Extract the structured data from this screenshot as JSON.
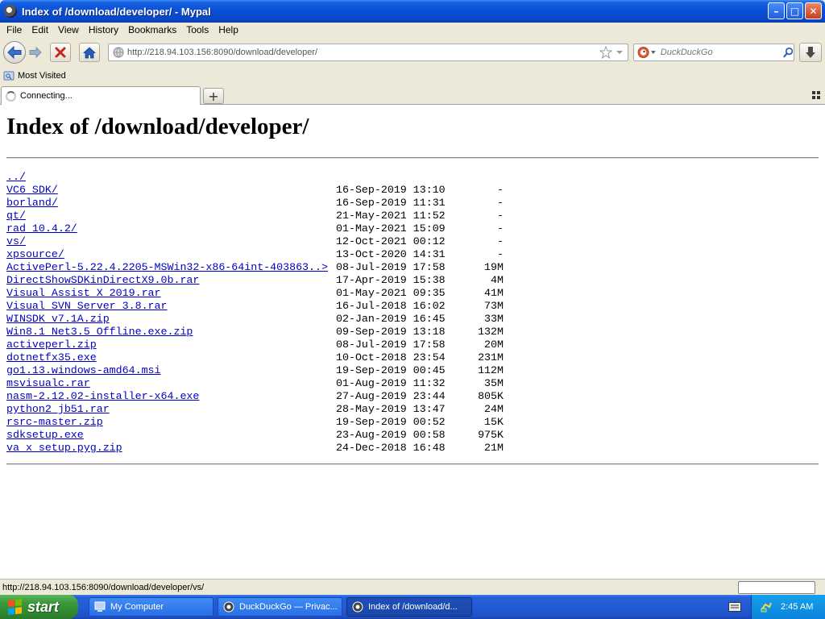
{
  "window": {
    "title": "Index of /download/developer/ - Mypal",
    "buttons": {
      "minimize": "–",
      "maximize": "□",
      "close": "✕"
    }
  },
  "menu": [
    "File",
    "Edit",
    "View",
    "History",
    "Bookmarks",
    "Tools",
    "Help"
  ],
  "nav": {
    "url": "http://218.94.103.156:8090/download/developer/",
    "search_placeholder": "DuckDuckGo"
  },
  "bookmarks": {
    "most_visited": "Most Visited"
  },
  "tab": {
    "label": "Connecting...",
    "new_tab": "+"
  },
  "page": {
    "heading": "Index of /download/developer/",
    "entries": [
      {
        "name": "../",
        "date": "",
        "size": ""
      },
      {
        "name": "VC6 SDK/",
        "date": "16-Sep-2019 13:10",
        "size": "-"
      },
      {
        "name": "borland/",
        "date": "16-Sep-2019 11:31",
        "size": "-"
      },
      {
        "name": "qt/",
        "date": "21-May-2021 11:52",
        "size": "-"
      },
      {
        "name": "rad 10.4.2/",
        "date": "01-May-2021 15:09",
        "size": "-"
      },
      {
        "name": "vs/",
        "date": "12-Oct-2021 00:12",
        "size": "-"
      },
      {
        "name": "xpsource/",
        "date": "13-Oct-2020 14:31",
        "size": "-"
      },
      {
        "name": "ActivePerl-5.22.4.2205-MSWin32-x86-64int-403863..>",
        "date": "08-Jul-2019 17:58",
        "size": "19M"
      },
      {
        "name": "DirectShowSDKinDirectX9.0b.rar",
        "date": "17-Apr-2019 15:38",
        "size": "4M"
      },
      {
        "name": "Visual Assist X 2019.rar",
        "date": "01-May-2021 09:35",
        "size": "41M"
      },
      {
        "name": "Visual SVN Server 3.8.rar",
        "date": "16-Jul-2018 16:02",
        "size": "73M"
      },
      {
        "name": "WINSDK v7.1A.zip",
        "date": "02-Jan-2019 16:45",
        "size": "33M"
      },
      {
        "name": "Win8.1 Net3.5 Offline.exe.zip",
        "date": "09-Sep-2019 13:18",
        "size": "132M"
      },
      {
        "name": "activeperl.zip",
        "date": "08-Jul-2019 17:58",
        "size": "20M"
      },
      {
        "name": "dotnetfx35.exe",
        "date": "10-Oct-2018 23:54",
        "size": "231M"
      },
      {
        "name": "go1.13.windows-amd64.msi",
        "date": "19-Sep-2019 00:45",
        "size": "112M"
      },
      {
        "name": "msvisualc.rar",
        "date": "01-Aug-2019 11:32",
        "size": "35M"
      },
      {
        "name": "nasm-2.12.02-installer-x64.exe",
        "date": "27-Aug-2019 23:44",
        "size": "805K"
      },
      {
        "name": "python2 jb51.rar",
        "date": "28-May-2019 13:47",
        "size": "24M"
      },
      {
        "name": "rsrc-master.zip",
        "date": "19-Sep-2019 00:52",
        "size": "15K"
      },
      {
        "name": "sdksetup.exe",
        "date": "23-Aug-2019 00:58",
        "size": "975K"
      },
      {
        "name": "va x setup.pyg.zip",
        "date": "24-Dec-2018 16:48",
        "size": "21M"
      }
    ]
  },
  "status": {
    "text": "http://218.94.103.156:8090/download/developer/vs/"
  },
  "taskbar": {
    "start": "start",
    "tasks": [
      "My Computer",
      "DuckDuckGo — Privac...",
      "Index of /download/d..."
    ],
    "clock": "2:45 AM"
  },
  "colors": {
    "link": "#0000cc",
    "titlebar": "#0a4fd6",
    "taskbar": "#235ad6",
    "start": "#3c9a3c"
  }
}
